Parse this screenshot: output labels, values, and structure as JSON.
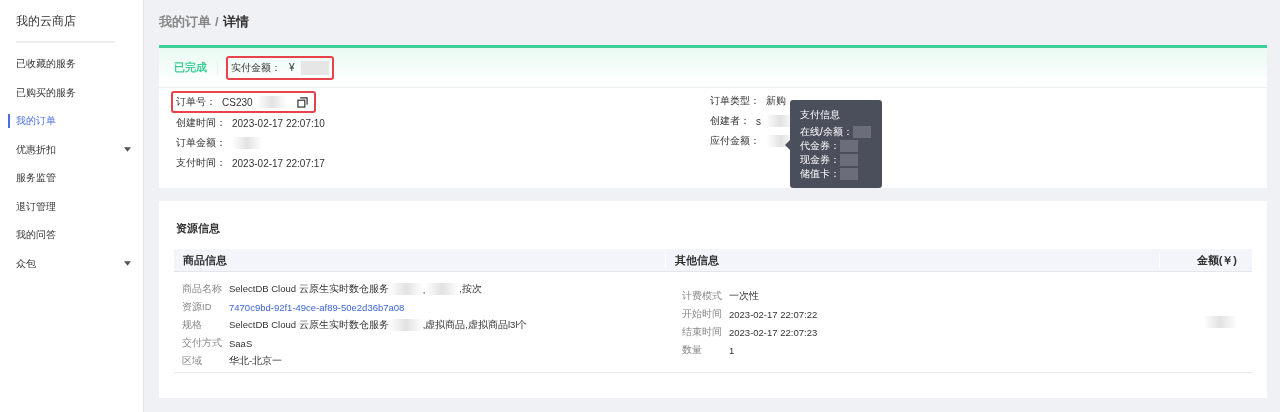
{
  "sidebar": {
    "title": "我的云商店",
    "items": [
      {
        "label": "已收藏的服务",
        "selected": false,
        "expandable": false
      },
      {
        "label": "已购买的服务",
        "selected": false,
        "expandable": false
      },
      {
        "label": "我的订单",
        "selected": true,
        "expandable": false
      },
      {
        "label": "优惠折扣",
        "selected": false,
        "expandable": true
      },
      {
        "label": "服务监管",
        "selected": false,
        "expandable": false
      },
      {
        "label": "退订管理",
        "selected": false,
        "expandable": false
      },
      {
        "label": "我的问答",
        "selected": false,
        "expandable": false
      },
      {
        "label": "众包",
        "selected": false,
        "expandable": true
      }
    ]
  },
  "breadcrumb": {
    "parent": "我的订单",
    "separator": "/",
    "current": "详情"
  },
  "order": {
    "status": "已完成",
    "paid": {
      "label": "实付金额：",
      "parts": [
        {
          "kind": "text",
          "text": "¥"
        },
        {
          "kind": "redacted"
        }
      ],
      "highlighted": true
    },
    "fields_left": [
      {
        "label": "订单号：",
        "parts": [
          {
            "kind": "text",
            "text": "CS230"
          },
          {
            "kind": "redacted"
          }
        ],
        "highlighted": true,
        "copyable": true
      },
      {
        "label": "创建时间：",
        "parts": [
          {
            "kind": "text",
            "text": "2023-02-17 22:07:10"
          }
        ],
        "highlighted": false,
        "copyable": false
      },
      {
        "label": "订单金额：",
        "parts": [
          {
            "kind": "redacted"
          }
        ],
        "highlighted": false,
        "copyable": false
      },
      {
        "label": "支付时间：",
        "parts": [
          {
            "kind": "text",
            "text": "2023-02-17 22:07:17"
          }
        ],
        "highlighted": false,
        "copyable": false
      }
    ],
    "fields_right": [
      {
        "label": "订单类型：",
        "parts": [
          {
            "kind": "text",
            "text": "新购"
          }
        ],
        "highlighted": false,
        "copyable": false
      },
      {
        "label": "创建者：",
        "parts": [
          {
            "kind": "text",
            "text": "s"
          },
          {
            "kind": "redacted"
          }
        ],
        "highlighted": false,
        "copyable": false
      },
      {
        "label": "应付金额：",
        "parts": [
          {
            "kind": "redacted"
          }
        ],
        "highlighted": false,
        "copyable": false
      }
    ]
  },
  "tooltip": {
    "title": "支付信息",
    "lines": [
      {
        "label": "在线/余额："
      },
      {
        "label": "代金券："
      },
      {
        "label": "现金券："
      },
      {
        "label": "储值卡："
      }
    ]
  },
  "resources": {
    "title": "资源信息",
    "columns": [
      "商品信息",
      "其他信息",
      "金额(￥)"
    ],
    "product_fields": [
      {
        "label": "商品名称",
        "parts": [
          {
            "kind": "text",
            "text": "SelectDB Cloud 云原生实时数仓服务"
          },
          {
            "kind": "redacted"
          },
          {
            "kind": "text",
            "text": ","
          },
          {
            "kind": "redacted"
          },
          {
            "kind": "text",
            "text": ",按次"
          }
        ]
      },
      {
        "label": "资源ID",
        "parts": [
          {
            "kind": "link",
            "text": "7470c9bd-92f1-49ce-af89-50e2d36b7a08"
          }
        ]
      },
      {
        "label": "规格",
        "parts": [
          {
            "kind": "text",
            "text": "SelectDB Cloud 云原生实时数仓服务"
          },
          {
            "kind": "redacted"
          },
          {
            "kind": "text",
            "text": ",虚拟商品,虚拟商品l3l个"
          }
        ]
      },
      {
        "label": "交付方式",
        "parts": [
          {
            "kind": "text",
            "text": "SaaS"
          }
        ]
      },
      {
        "label": "区域",
        "parts": [
          {
            "kind": "text",
            "text": "华北-北京一"
          }
        ]
      }
    ],
    "other_fields": [
      {
        "label": "计费模式",
        "parts": [
          {
            "kind": "text",
            "text": "一次性"
          }
        ]
      },
      {
        "label": "开始时间",
        "parts": [
          {
            "kind": "text",
            "text": "2023-02-17 22:07:22"
          }
        ]
      },
      {
        "label": "结束时间",
        "parts": [
          {
            "kind": "text",
            "text": "2023-02-17 22:07:23"
          }
        ]
      },
      {
        "label": "数量",
        "parts": [
          {
            "kind": "text",
            "text": "1"
          }
        ]
      }
    ],
    "amount": {
      "parts": [
        {
          "kind": "redacted"
        }
      ]
    }
  }
}
